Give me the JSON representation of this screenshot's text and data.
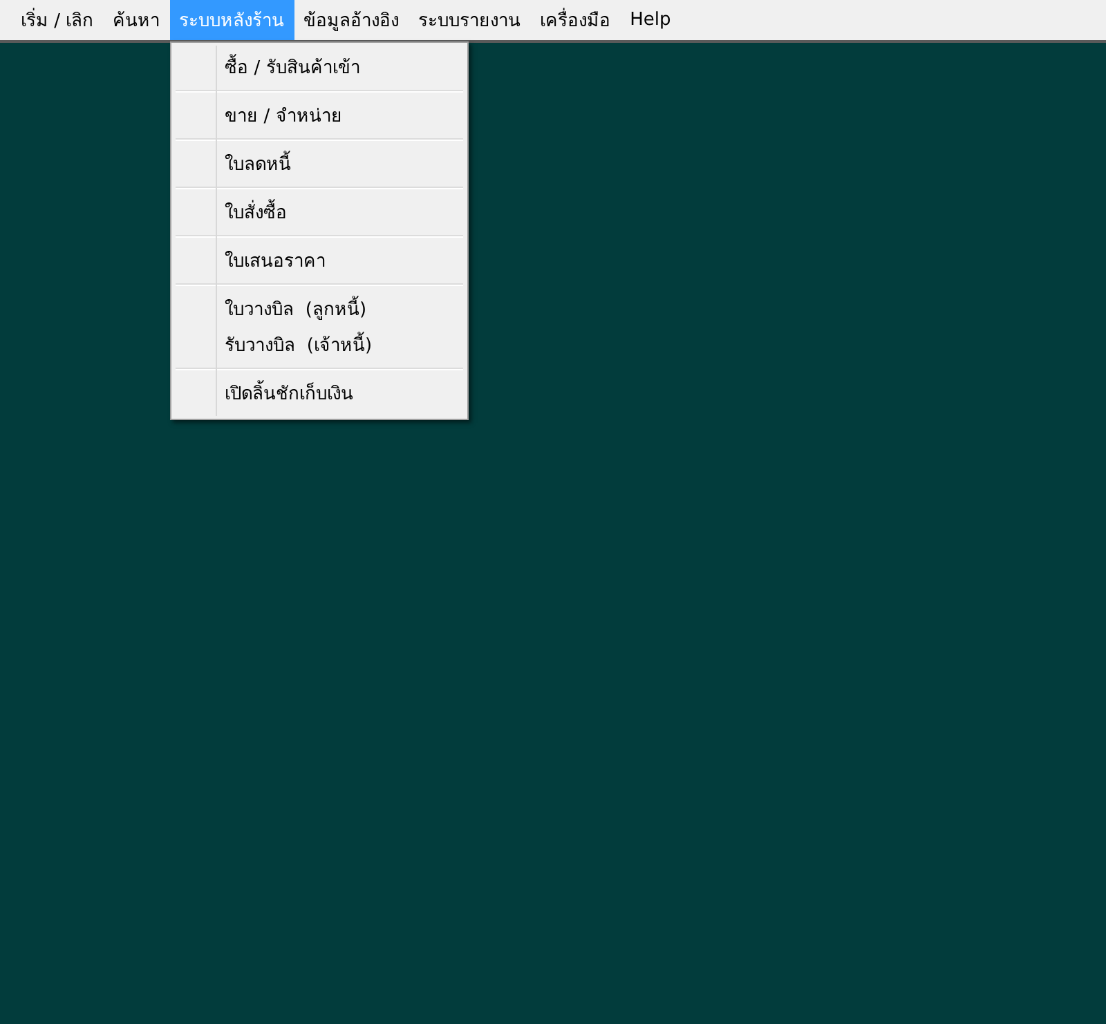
{
  "menu_bar": [
    {
      "label": "เริ่ม / เลิก",
      "selected": false
    },
    {
      "label": "ค้นหา",
      "selected": false
    },
    {
      "label": "ระบบหลังร้าน",
      "selected": true
    },
    {
      "label": "ข้อมูลอ้างอิง",
      "selected": false
    },
    {
      "label": "ระบบรายงาน",
      "selected": false
    },
    {
      "label": "เครื่องมือ",
      "selected": false
    },
    {
      "label": "Help",
      "selected": false
    }
  ],
  "dropdown": {
    "sections": [
      [
        "ซื้อ / รับสินค้าเข้า"
      ],
      [
        "ขาย / จำหน่าย"
      ],
      [
        "ใบลดหนี้"
      ],
      [
        "ใบสั่งซื้อ"
      ],
      [
        "ใบเสนอราคา"
      ],
      [
        "ใบวางบิล  (ลูกหนี้)",
        "รับวางบิล  (เจ้าหนี้)"
      ],
      [
        "เปิดลิ้นชักเก็บเงิน"
      ]
    ]
  }
}
